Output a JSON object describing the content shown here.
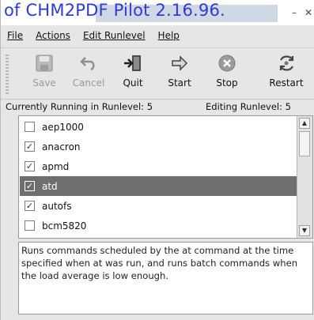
{
  "window": {
    "title": "of CHM2PDF Pilot 2.16.96.",
    "buttons": {
      "minimize": "–",
      "close": "✕"
    }
  },
  "menubar": {
    "items": [
      "File",
      "Actions",
      "Edit Runlevel",
      "Help"
    ]
  },
  "toolbar": {
    "buttons": [
      {
        "label": "Save",
        "icon": "floppy-disk-icon",
        "enabled": false
      },
      {
        "label": "Cancel",
        "icon": "undo-arrow-icon",
        "enabled": false
      },
      {
        "label": "Quit",
        "icon": "exit-door-icon",
        "enabled": true
      },
      {
        "label": "Start",
        "icon": "right-arrow-icon",
        "enabled": true
      },
      {
        "label": "Stop",
        "icon": "stop-circle-icon",
        "enabled": true
      },
      {
        "label": "Restart",
        "icon": "restart-cycle-icon",
        "enabled": true
      }
    ]
  },
  "status": {
    "running": "Currently Running in Runlevel: 5",
    "editing": "Editing Runlevel: 5"
  },
  "services": [
    {
      "name": "aep1000",
      "checked": false,
      "selected": false
    },
    {
      "name": "anacron",
      "checked": true,
      "selected": false
    },
    {
      "name": "apmd",
      "checked": true,
      "selected": false
    },
    {
      "name": "atd",
      "checked": true,
      "selected": true
    },
    {
      "name": "autofs",
      "checked": true,
      "selected": false
    },
    {
      "name": "bcm5820",
      "checked": false,
      "selected": false
    }
  ],
  "description": "Runs commands scheduled by the at command at the time specified when at was run, and runs batch commands when the load average is low enough.",
  "colors": {
    "title_text": "#2f3bd6",
    "selection": "#6e6e6e",
    "window_bg": "#e6e6e6"
  }
}
